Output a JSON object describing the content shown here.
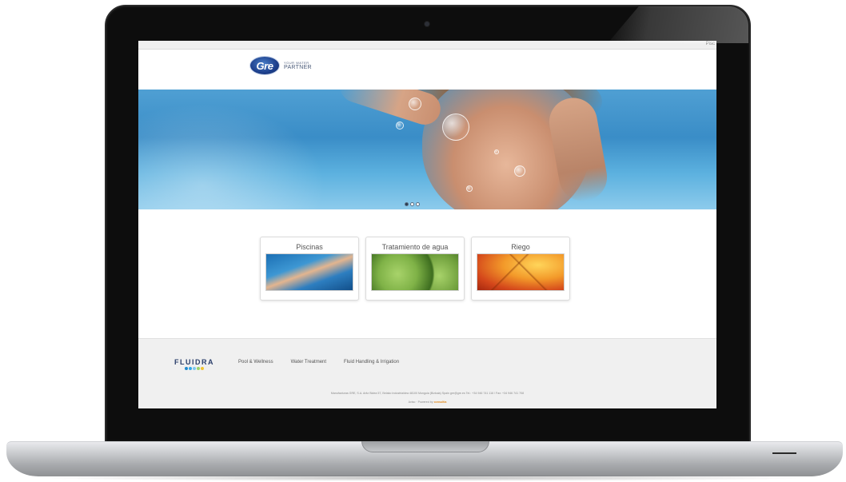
{
  "topbar": {
    "link": "Pisc"
  },
  "header": {
    "logo_mark": "Gre",
    "tagline_small": "YOUR WATER",
    "tagline_big": "PARTNER"
  },
  "hero": {
    "slides": 3,
    "active_slide": 1
  },
  "cards": [
    {
      "title": "Piscinas",
      "image": "pool-swimmer-image"
    },
    {
      "title": "Tratamiento de agua",
      "image": "green-apples-image"
    },
    {
      "title": "Riego",
      "image": "orange-leaf-image"
    }
  ],
  "footer": {
    "brand": "FLUIDRA",
    "brand_dot_colors": [
      "#1f8ad0",
      "#35a7e6",
      "#7cc8ef",
      "#9bd46a",
      "#f2c530"
    ],
    "nav": [
      "Pool & Wellness",
      "Water Treatment",
      "Fluid Handling & Irrigation"
    ],
    "info": "Manufacturas GRE, S.A.    Aritz Bidea 57, Belako Industrialdea    48100 Munguia (Bizkaia) Spain    gre@gre.es    Tel.: +34 946 741 116 / Fax: +34 946 741 708",
    "credit_prefix": "Aviso ·  Powered by",
    "credit_brand": "consultia"
  },
  "colors": {
    "accent": "#1d3f8c",
    "hero_blue": "#3a8dc7",
    "footer_bg": "#f0f0f0"
  }
}
